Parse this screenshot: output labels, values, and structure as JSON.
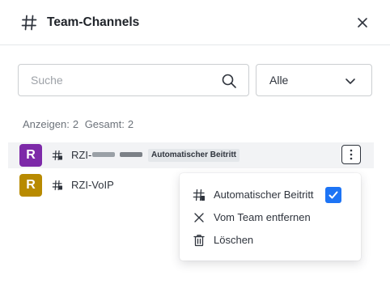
{
  "header": {
    "title": "Team-Channels",
    "icon": "hash-icon",
    "close_icon": "close-icon"
  },
  "search": {
    "placeholder": "Suche",
    "value": ""
  },
  "filter": {
    "selected": "Alle"
  },
  "counts": {
    "showing_label": "Anzeigen:",
    "showing_value": "2",
    "total_label": "Gesamt:",
    "total_value": "2"
  },
  "channels": [
    {
      "avatar_letter": "R",
      "avatar_color": "#7d2aa8",
      "name": "RZI-",
      "name_obscured": true,
      "badge": "Automatischer Beitritt",
      "hovered": true
    },
    {
      "avatar_letter": "R",
      "avatar_color": "#b88a00",
      "name": "RZI-VoIP",
      "badge": "",
      "hovered": false
    }
  ],
  "context_menu": {
    "items": [
      {
        "label": "Automatischer Beitritt",
        "icon": "channel-auto-join-icon",
        "checkbox": true,
        "checked": true
      },
      {
        "label": "Vom Team entfernen",
        "icon": "close-icon"
      },
      {
        "label": "Löschen",
        "icon": "trash-icon"
      }
    ]
  },
  "colors": {
    "accent": "#1d74f5",
    "text": "#2f343d",
    "muted": "#6c727a",
    "border": "#cbced1"
  }
}
